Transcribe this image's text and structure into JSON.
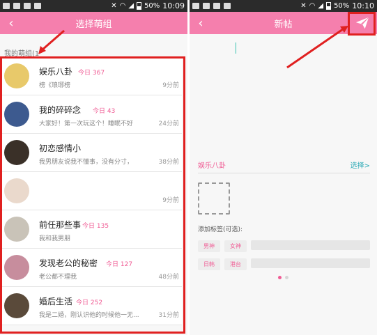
{
  "status_left": {
    "time": "10:09",
    "battery": "50%"
  },
  "status_right": {
    "time": "10:10",
    "battery": "50%"
  },
  "colors": {
    "accent": "#f57fad",
    "pink_text": "#f05d95",
    "annotation_red": "#e02020",
    "teal": "#2aa9b5"
  },
  "screen1": {
    "title": "选择萌组",
    "back_icon": "chevron-left-icon",
    "section_label": "我的萌组(1",
    "groups": [
      {
        "name": "娱乐八卦",
        "today": "今日 367",
        "preview": "榜《琅琊榜",
        "time": "9分前",
        "avatar": "#e8c96a"
      },
      {
        "name": "我的碎碎念",
        "today": "今日 43",
        "preview": "大家好！第一次玩这个！睡眠不好",
        "time": "24分前",
        "avatar": "#3d5a8f"
      },
      {
        "name": "初恋感情小",
        "today": "",
        "preview": "我男朋友说我不懂事，没有分寸，",
        "time": "38分前",
        "avatar": "#3a3028"
      },
      {
        "name": "",
        "today": "",
        "preview": "",
        "time": "9分前",
        "avatar": "#ead9cc"
      },
      {
        "name": "前任那些事",
        "today": "今日 135",
        "preview": "我和我男朋",
        "time": "",
        "avatar": "#c9c3b8"
      },
      {
        "name": "发现老公的秘密",
        "today": "今日 127",
        "preview": "老公都不理我",
        "time": "48分前",
        "avatar": "#c78d9d"
      },
      {
        "name": "婚后生活",
        "today": "今日 252",
        "preview": "我是二婚，刚认识他的时候他一无...",
        "time": "31分前",
        "avatar": "#5a4a3a"
      }
    ]
  },
  "screen2": {
    "title": "新帖",
    "back_icon": "chevron-left-icon",
    "send_icon": "paper-plane-send-icon",
    "group_name": "娱乐八卦",
    "choose_label": "选择>",
    "tag_label": "添加标签(可选):",
    "tags_row1": [
      "男神",
      "女神"
    ],
    "tags_row2": [
      "日韩",
      "港台"
    ]
  }
}
